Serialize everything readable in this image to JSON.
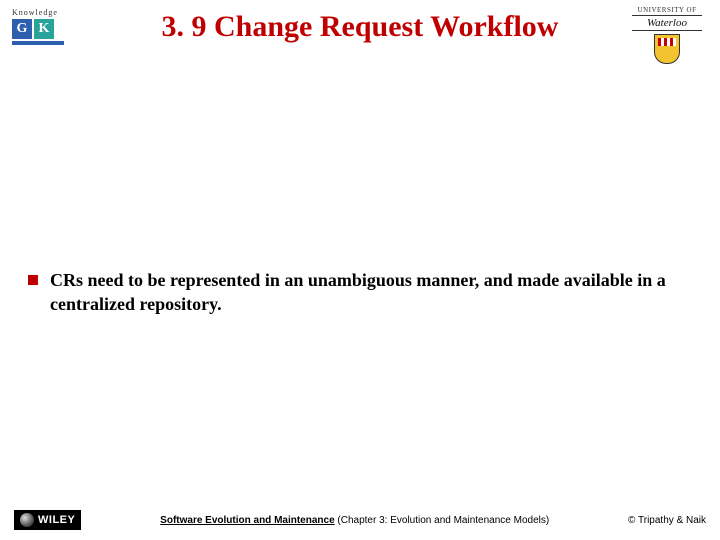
{
  "title": "3. 9 Change Request Workflow",
  "logos": {
    "left": {
      "knowledge": "Knowledge",
      "g": "G",
      "k": "K"
    },
    "right": {
      "top": "UNIVERSITY OF",
      "name": "Waterloo"
    }
  },
  "bullets": [
    "CRs need to be represented in an unambiguous manner, and made available in a centralized repository."
  ],
  "footer": {
    "publisher": "WILEY",
    "center_title": "Software Evolution and Maintenance",
    "center_sub": " (Chapter 3: Evolution and Maintenance Models)",
    "right": "© Tripathy & Naik"
  }
}
